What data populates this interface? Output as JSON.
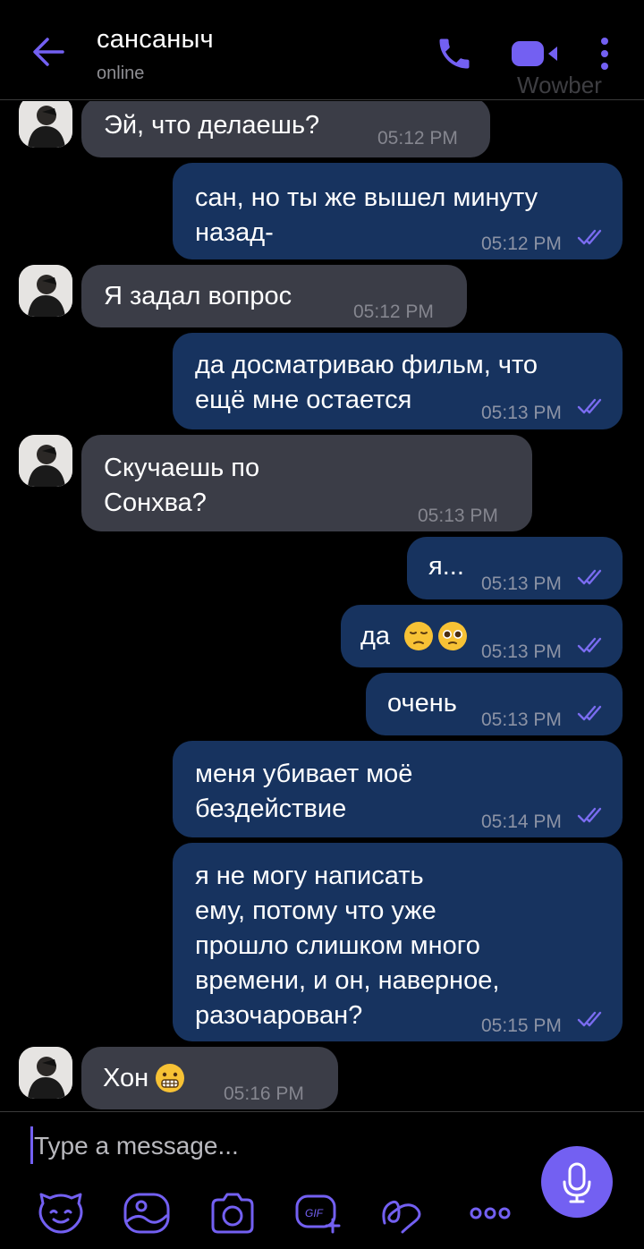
{
  "header": {
    "contact_name": "сансаныч",
    "status": "online",
    "watermark": "Wowber"
  },
  "messages": [
    {
      "direction": "in",
      "text": "Эй, что делаешь?",
      "time": "05:12 PM"
    },
    {
      "direction": "out",
      "text": "сан, но ты же вышел минуту\nназад-",
      "time": "05:12 PM",
      "read": true
    },
    {
      "direction": "in",
      "text": "Я задал вопрос",
      "time": "05:12 PM"
    },
    {
      "direction": "out",
      "text": "да досматриваю фильм, что\nещё мне остается",
      "time": "05:13 PM",
      "read": true
    },
    {
      "direction": "in",
      "text": "Скучаешь по\nСонхва?",
      "time": "05:13 PM"
    },
    {
      "direction": "out",
      "text": "я...",
      "time": "05:13 PM",
      "read": true
    },
    {
      "direction": "out",
      "text": "да",
      "emoji": [
        "pensive-face",
        "pleading-face"
      ],
      "time": "05:13 PM",
      "read": true
    },
    {
      "direction": "out",
      "text": "очень",
      "time": "05:13 PM",
      "read": true
    },
    {
      "direction": "out",
      "text": "меня убивает моё\nбездействие",
      "time": "05:14 PM",
      "read": true
    },
    {
      "direction": "out",
      "text": "я не могу написать\nему, потому что уже\nпрошло слишком много\nвремени, и он, наверное,\nразочарован?",
      "time": "05:15 PM",
      "read": true
    },
    {
      "direction": "in",
      "text": "Хон",
      "emoji": [
        "grimacing-face"
      ],
      "time": "05:16 PM"
    }
  ],
  "composer": {
    "placeholder": "Type a message...",
    "tools": [
      "sticker-icon",
      "image-icon",
      "camera-icon",
      "gif-icon",
      "doodle-icon",
      "more-dots-icon"
    ]
  },
  "colors": {
    "accent": "#7360f2",
    "incoming_bubble": "#3b3d47",
    "outgoing_bubble": "#17335f",
    "background": "#000000"
  }
}
